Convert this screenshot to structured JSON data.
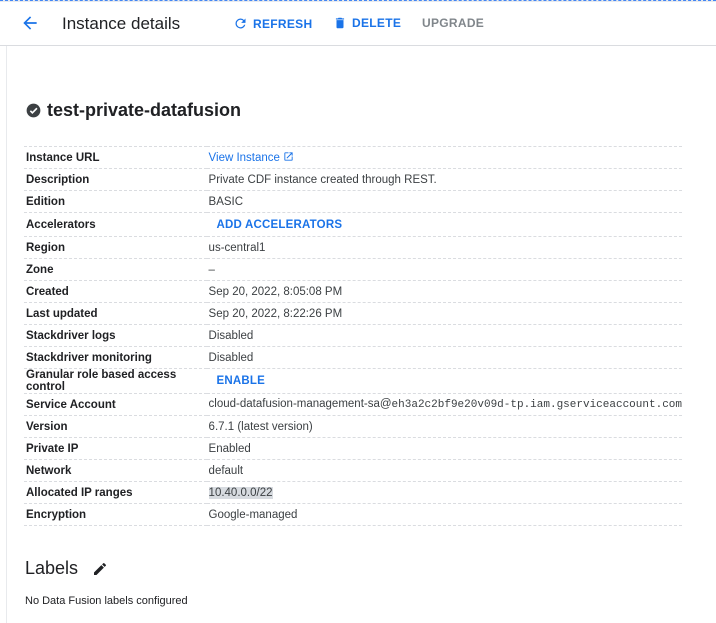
{
  "toolbar": {
    "title": "Instance details",
    "refresh_label": "REFRESH",
    "delete_label": "DELETE",
    "upgrade_label": "UPGRADE"
  },
  "instance": {
    "name": "test-private-datafusion"
  },
  "details": {
    "instance_url_label": "Instance URL",
    "instance_url_value": "View Instance",
    "description_label": "Description",
    "description_value": "Private CDF instance created through REST.",
    "edition_label": "Edition",
    "edition_value": "BASIC",
    "accelerators_label": "Accelerators",
    "accelerators_action": "ADD ACCELERATORS",
    "region_label": "Region",
    "region_value": "us-central1",
    "zone_label": "Zone",
    "zone_value": "–",
    "created_label": "Created",
    "created_value": "Sep 20, 2022, 8:05:08 PM",
    "last_updated_label": "Last updated",
    "last_updated_value": "Sep 20, 2022, 8:22:26 PM",
    "stackdriver_logs_label": "Stackdriver logs",
    "stackdriver_logs_value": "Disabled",
    "stackdriver_monitoring_label": "Stackdriver monitoring",
    "stackdriver_monitoring_value": "Disabled",
    "granular_label": "Granular role based access control",
    "granular_action": "ENABLE",
    "service_account_label": "Service Account",
    "service_account_prefix": "cloud-datafusion-management-sa@",
    "service_account_domain": "eh3a2c2bf9e20v09d-tp.iam.gserviceaccount.com",
    "version_label": "Version",
    "version_value": "6.7.1 (latest version)",
    "private_ip_label": "Private IP",
    "private_ip_value": "Enabled",
    "network_label": "Network",
    "network_value": "default",
    "ip_ranges_label": "Allocated IP ranges",
    "ip_ranges_value": "10.40.0.0/22",
    "encryption_label": "Encryption",
    "encryption_value": "Google-managed"
  },
  "labels": {
    "title": "Labels",
    "empty_text": "No Data Fusion labels configured"
  },
  "colors": {
    "accent": "#1a73e8",
    "text": "#202124",
    "muted": "#3c4043",
    "disabled": "#80868b"
  },
  "icons": [
    "back-arrow-icon",
    "refresh-icon",
    "trash-icon",
    "check-circle-icon",
    "open-in-new-icon",
    "pencil-icon"
  ]
}
